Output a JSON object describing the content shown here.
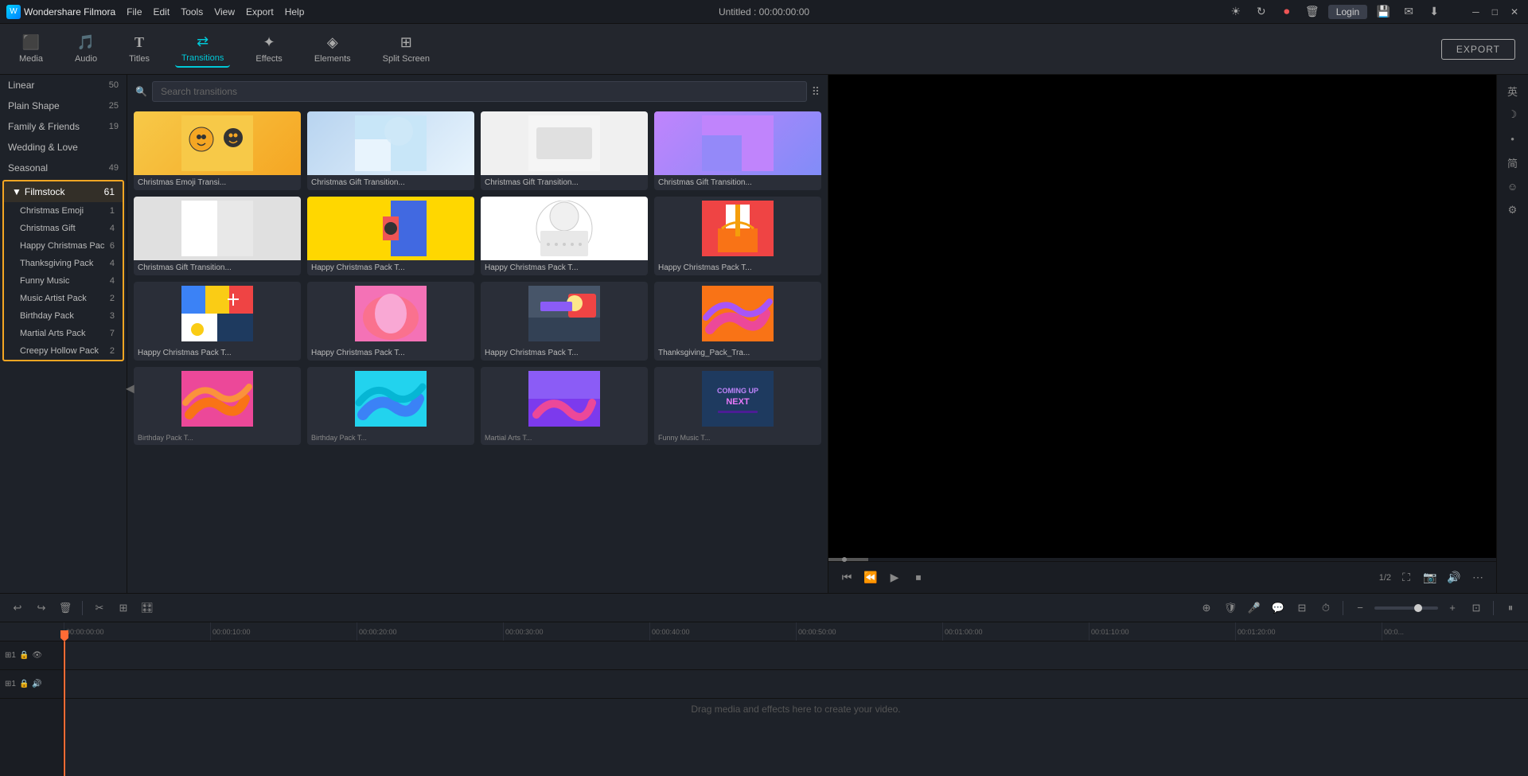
{
  "app": {
    "name": "Wondershare Filmora",
    "title": "Untitled : 00:00:00:00"
  },
  "titlebar": {
    "menus": [
      "File",
      "Edit",
      "Tools",
      "View",
      "Export",
      "Help"
    ],
    "login": "Login",
    "minimize": "─",
    "maximize": "□",
    "close": "✕"
  },
  "toolbar": {
    "items": [
      {
        "id": "media",
        "label": "Media",
        "icon": "🎬"
      },
      {
        "id": "audio",
        "label": "Audio",
        "icon": "🎵"
      },
      {
        "id": "titles",
        "label": "Titles",
        "icon": "T"
      },
      {
        "id": "transitions",
        "label": "Transitions",
        "icon": "⇄"
      },
      {
        "id": "effects",
        "label": "Effects",
        "icon": "✦"
      },
      {
        "id": "elements",
        "label": "Elements",
        "icon": "◈"
      },
      {
        "id": "splitscreen",
        "label": "Split Screen",
        "icon": "⊞"
      }
    ],
    "export_label": "EXPORT"
  },
  "sidebar": {
    "items": [
      {
        "id": "linear",
        "label": "Linear",
        "count": "50"
      },
      {
        "id": "plain-shape",
        "label": "Plain Shape",
        "count": "25"
      },
      {
        "id": "family-friends",
        "label": "Family & Friends",
        "count": "19"
      },
      {
        "id": "wedding-love",
        "label": "Wedding & Love",
        "count": ""
      },
      {
        "id": "seasonal",
        "label": "Seasonal",
        "count": "49"
      }
    ],
    "group": {
      "label": "Filmstock",
      "count": "61",
      "subitems": [
        {
          "id": "christmas-emoji",
          "label": "Christmas Emoji",
          "count": "1"
        },
        {
          "id": "christmas-gift",
          "label": "Christmas Gift",
          "count": "4"
        },
        {
          "id": "happy-christmas-pack",
          "label": "Happy Christmas Pac",
          "count": "6"
        },
        {
          "id": "thanksgiving-pack",
          "label": "Thanksgiving Pack",
          "count": "4"
        },
        {
          "id": "funny-music",
          "label": "Funny Music",
          "count": "4"
        },
        {
          "id": "music-artist-pack",
          "label": "Music Artist Pack",
          "count": "2"
        },
        {
          "id": "birthday-pack",
          "label": "Birthday Pack",
          "count": "3"
        },
        {
          "id": "martial-arts-pack",
          "label": "Martial Arts Pack",
          "count": "7"
        },
        {
          "id": "creepy-hollow-pack",
          "label": "Creepy Hollow Pack",
          "count": "2"
        }
      ]
    }
  },
  "search": {
    "placeholder": "Search transitions"
  },
  "transitions": [
    {
      "id": 1,
      "label": "Christmas Emoji Transi...",
      "thumb": "emoji"
    },
    {
      "id": 2,
      "label": "Christmas Gift Transition...",
      "thumb": "blue-sky"
    },
    {
      "id": 3,
      "label": "Christmas Gift Transition...",
      "thumb": "white"
    },
    {
      "id": 4,
      "label": "Christmas Gift Transition...",
      "thumb": "purple"
    },
    {
      "id": 5,
      "label": "Christmas Gift Transition...",
      "thumb": "yellow-robot"
    },
    {
      "id": 6,
      "label": "Happy Christmas Pack T...",
      "thumb": "flag"
    },
    {
      "id": 7,
      "label": "Happy Christmas Pack T...",
      "thumb": "dotted"
    },
    {
      "id": 8,
      "label": "Happy Christmas Pack T...",
      "thumb": "gift-red"
    },
    {
      "id": 9,
      "label": "Happy Christmas Pack T...",
      "thumb": "colorful"
    },
    {
      "id": 10,
      "label": "Happy Christmas Pack T...",
      "thumb": "pink"
    },
    {
      "id": 11,
      "label": "Happy Christmas Pack T...",
      "thumb": "winter"
    },
    {
      "id": 12,
      "label": "Thanksgiving_Pack_Tra...",
      "thumb": "serpent"
    },
    {
      "id": 13,
      "label": "",
      "thumb": "serpent2"
    },
    {
      "id": 14,
      "label": "",
      "thumb": "blue-serpent"
    },
    {
      "id": 15,
      "label": "",
      "thumb": "fantasy"
    },
    {
      "id": 16,
      "label": "",
      "thumb": "coming-up"
    }
  ],
  "timeline": {
    "timecodes": [
      "00:00:00:00",
      "00:00:10:00",
      "00:00:20:00",
      "00:00:30:00",
      "00:00:40:00",
      "00:00:50:00",
      "00:01:00:00",
      "00:01:10:00",
      "00:01:20:00",
      "00:0..."
    ],
    "page": "1/2",
    "drag_hint": "Drag media and effects here to create your video."
  },
  "preview": {
    "page_label": "1/2"
  },
  "right_panel_icons": [
    "英",
    "☽",
    "•",
    "简",
    "☺",
    "⚙"
  ]
}
